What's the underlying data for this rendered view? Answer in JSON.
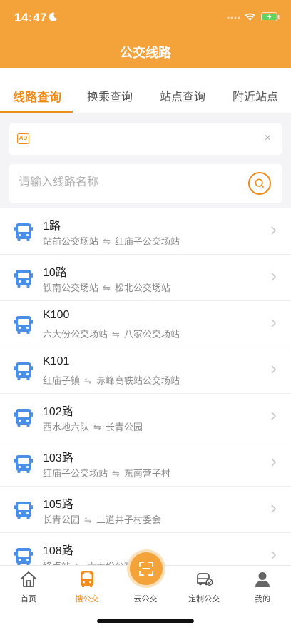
{
  "status_bar": {
    "time": "14:47"
  },
  "nav": {
    "title": "公交线路"
  },
  "tabs": [
    {
      "label": "线路查询",
      "active": true
    },
    {
      "label": "换乘查询",
      "active": false
    },
    {
      "label": "站点查询",
      "active": false
    },
    {
      "label": "附近站点",
      "active": false
    }
  ],
  "ad": {
    "badge": "AD",
    "close": "×"
  },
  "search": {
    "placeholder": "请输入线路名称",
    "value": ""
  },
  "routes": [
    {
      "name": "1路",
      "from": "站前公交场站",
      "to": "红庙子公交场站"
    },
    {
      "name": "10路",
      "from": "铁南公交场站",
      "to": "松北公交场站"
    },
    {
      "name": "K100",
      "from": "六大份公交场站",
      "to": "八家公交场站"
    },
    {
      "name": "K101",
      "from": "红庙子镇",
      "to": "赤峰高铁站公交场站"
    },
    {
      "name": "102路",
      "from": "西水地六队",
      "to": "长青公园"
    },
    {
      "name": "103路",
      "from": "红庙子公交场站",
      "to": "东南营子村"
    },
    {
      "name": "105路",
      "from": "长青公园",
      "to": "二道井子村委会"
    },
    {
      "name": "108路",
      "from": "终点站",
      "to": "六大份公交场站"
    }
  ],
  "arrow_glyph": "⇋",
  "bottom_nav": [
    {
      "label": "首页",
      "icon": "home-icon",
      "active": false
    },
    {
      "label": "搜公交",
      "icon": "bus-icon",
      "active": true
    },
    {
      "label": "云公交",
      "icon": "scan-icon",
      "active": false
    },
    {
      "label": "定制公交",
      "icon": "custom-bus-icon",
      "active": false
    },
    {
      "label": "我的",
      "icon": "user-icon",
      "active": false
    }
  ],
  "colors": {
    "accent": "#f08c1a",
    "header": "#f4a23a",
    "bus_icon": "#4a8fe7"
  }
}
